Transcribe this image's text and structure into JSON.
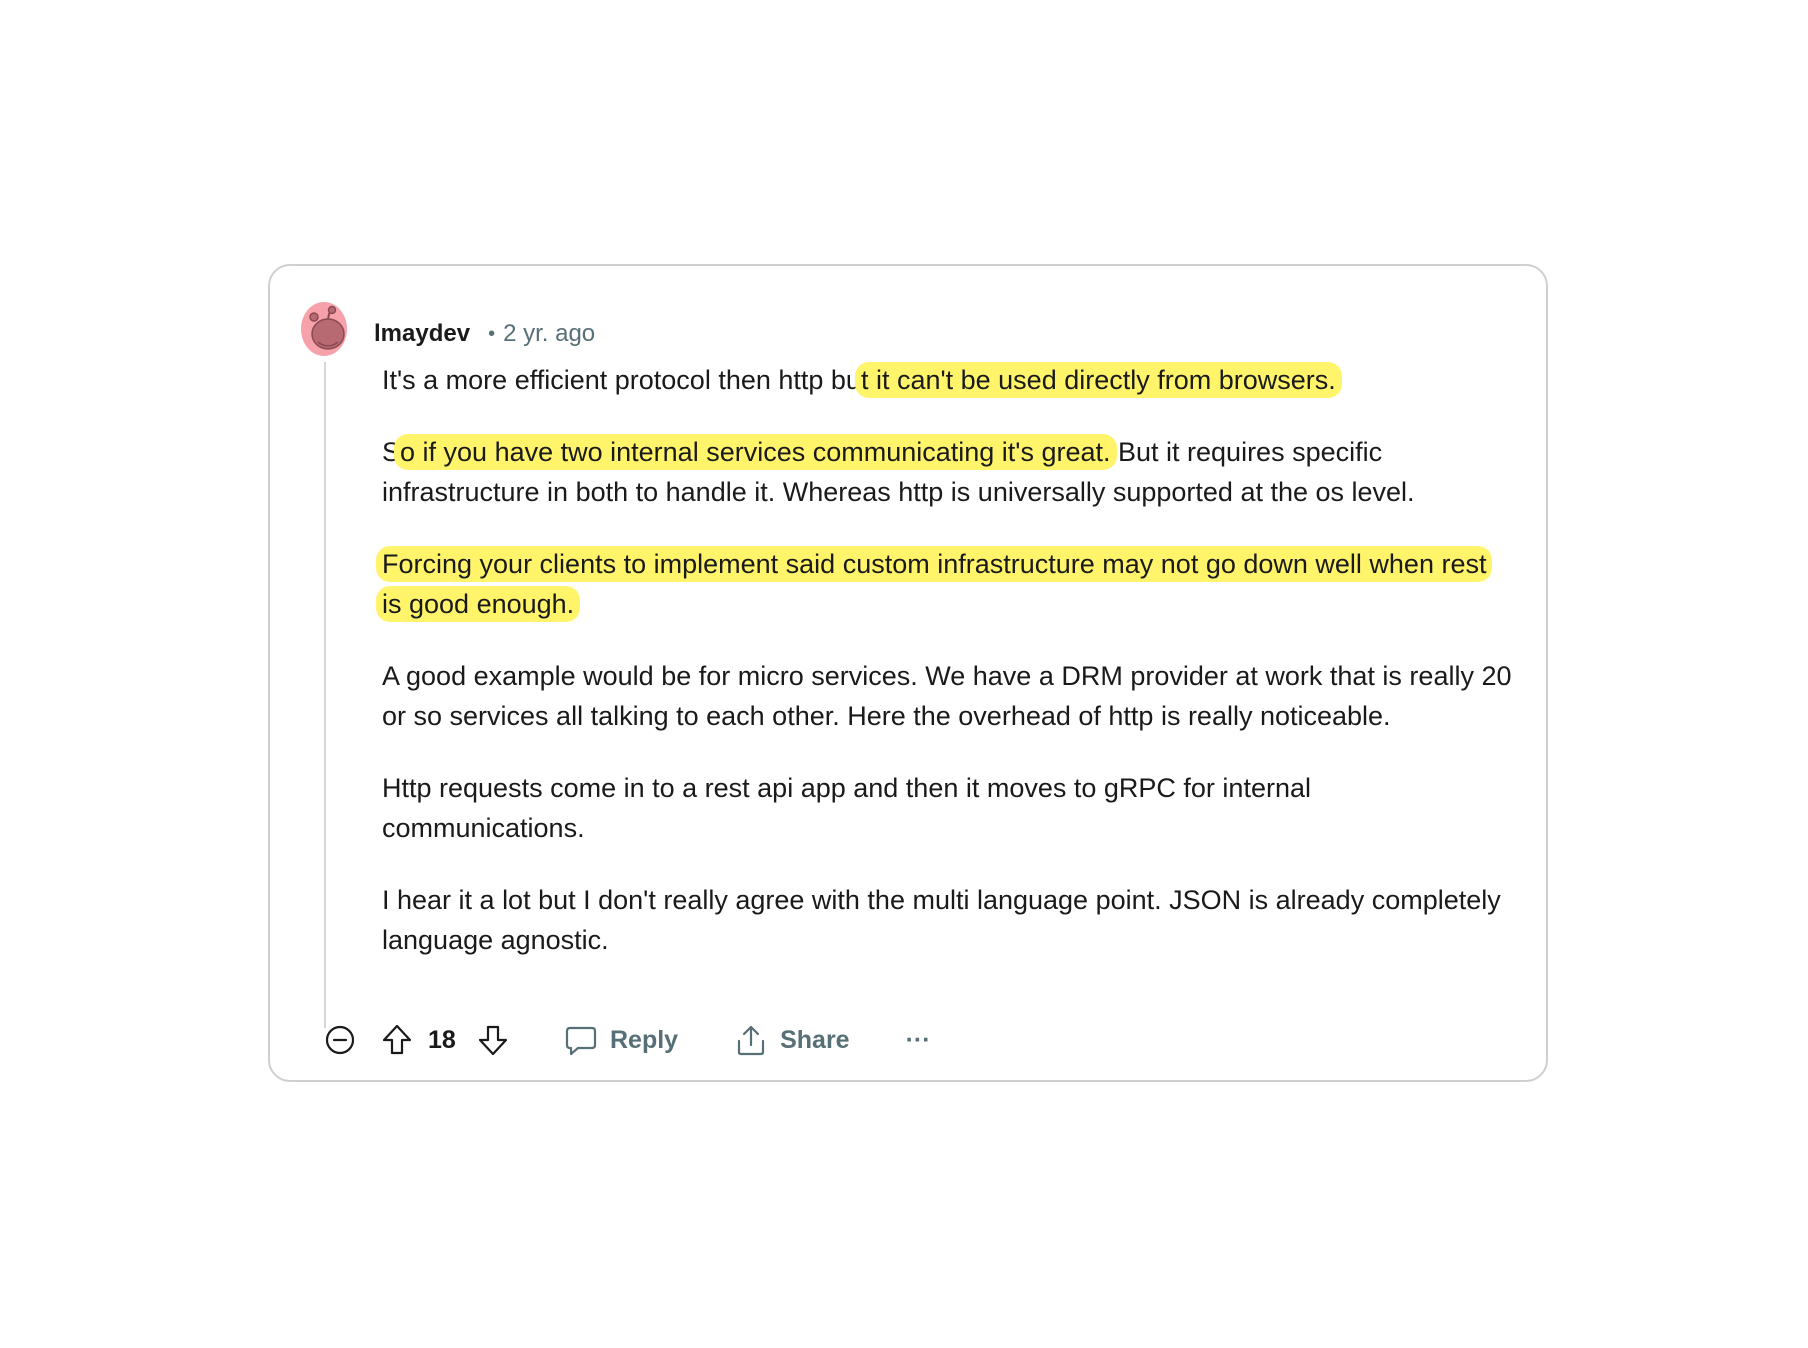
{
  "comment": {
    "author": "lmaydev",
    "separator": "•",
    "timestamp": "2 yr. ago",
    "avatar_icon": "reddit-snoo-avatar-icon",
    "paragraphs": [
      {
        "segments": [
          {
            "text": "It's a more efficient protocol then http bu",
            "highlight": false
          },
          {
            "text": "t it can't be used directly from browsers.",
            "highlight": true
          }
        ]
      },
      {
        "segments": [
          {
            "text": "S",
            "highlight": false
          },
          {
            "text": "o if you have two internal services communicating it's great.",
            "highlight": true
          },
          {
            "text": " But it requires specific infrastructure in both to handle it. Whereas http is universally supported at the os level.",
            "highlight": false
          }
        ]
      },
      {
        "segments": [
          {
            "text": "Forcing your clients to implement said custom infrastructure may not go down well when rest is good enough.",
            "highlight": true
          }
        ]
      },
      {
        "segments": [
          {
            "text": "A good example would be for micro services. We have a DRM provider at work that is really 20 or so services all talking to each other. Here the overhead of http is really noticeable.",
            "highlight": false
          }
        ]
      },
      {
        "segments": [
          {
            "text": "Http requests come in to a rest api app and then it moves to gRPC for internal communications.",
            "highlight": false
          }
        ]
      },
      {
        "segments": [
          {
            "text": "I hear it a lot but I don't really agree with the multi language point. JSON is already completely language agnostic.",
            "highlight": false
          }
        ]
      }
    ]
  },
  "actions": {
    "collapse_icon": "collapse-minus-icon",
    "upvote_icon": "upvote-arrow-icon",
    "score": "18",
    "downvote_icon": "downvote-arrow-icon",
    "reply_label": "Reply",
    "reply_icon": "comment-bubble-icon",
    "share_label": "Share",
    "share_icon": "share-icon",
    "more_label": "···"
  },
  "colors": {
    "highlight": "#fff46a",
    "meta_text": "#576f76",
    "body_text": "#1a1a1b",
    "avatar_bg": "#f7a1ab",
    "card_border": "#cfcfcf"
  }
}
